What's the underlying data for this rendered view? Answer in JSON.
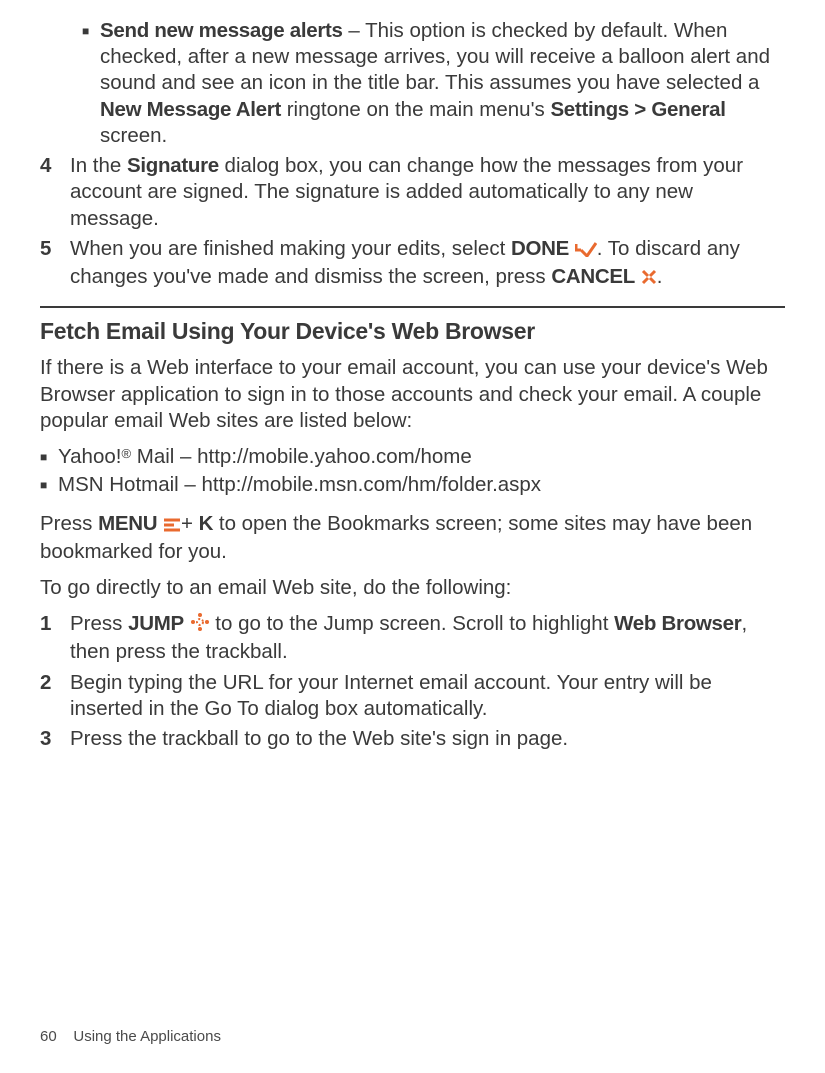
{
  "sub_bullet": {
    "title": "Send new message alerts",
    "dash": " – ",
    "text1": "This option is checked by default. When checked, after a new message arrives, you will receive a balloon alert and sound and see an icon in the title bar. This assumes you have selected a ",
    "bold1": "New Message Alert",
    "text2": " ringtone on the main menu's ",
    "bold2": "Settings > General",
    "text3": " screen."
  },
  "step4": {
    "num": "4",
    "t1": "In the ",
    "b1": "Signature",
    "t2": " dialog box, you can change how the messages from your account are signed. The signature is added automatically to any new message."
  },
  "step5": {
    "num": "5",
    "t1": "When you are finished making your edits, select ",
    "b1": "DONE",
    "t2": ". To discard any changes you've made and dismiss the screen, press ",
    "b2": "CANCEL",
    "t3": "."
  },
  "section_title": "Fetch Email Using Your Device's Web Browser",
  "intro": "If there is a Web interface to your email account, you can use your device's Web Browser application to sign in to those accounts and check your email. A couple popular email Web sites are listed below:",
  "sites": {
    "yahoo_pre": "Yahoo!",
    "yahoo_reg": "®",
    "yahoo_post": "  Mail  – http://mobile.yahoo.com/home",
    "msn": "MSN Hotmail – http://mobile.msn.com/hm/folder.aspx"
  },
  "bookmarks": {
    "t1": "Press ",
    "b1": "MENU",
    "t2": "+ ",
    "b2": "K",
    "t3": " to open the Bookmarks screen; some sites may have been bookmarked for you."
  },
  "direct": "To go directly to an email Web site, do the following:",
  "d1": {
    "num": "1",
    "t1": "Press ",
    "b1": "JUMP",
    "t2": " to go to the Jump screen. Scroll to highlight ",
    "b2": "Web Browser",
    "t3": ", then press the trackball."
  },
  "d2": {
    "num": "2",
    "t1": "Begin typing the URL for your Internet email account. Your entry will be inserted in the Go To dialog box automatically."
  },
  "d3": {
    "num": "3",
    "t1": "Press the trackball to go to the Web site's sign in page."
  },
  "footer": {
    "page": "60",
    "label": "Using the Applications"
  }
}
